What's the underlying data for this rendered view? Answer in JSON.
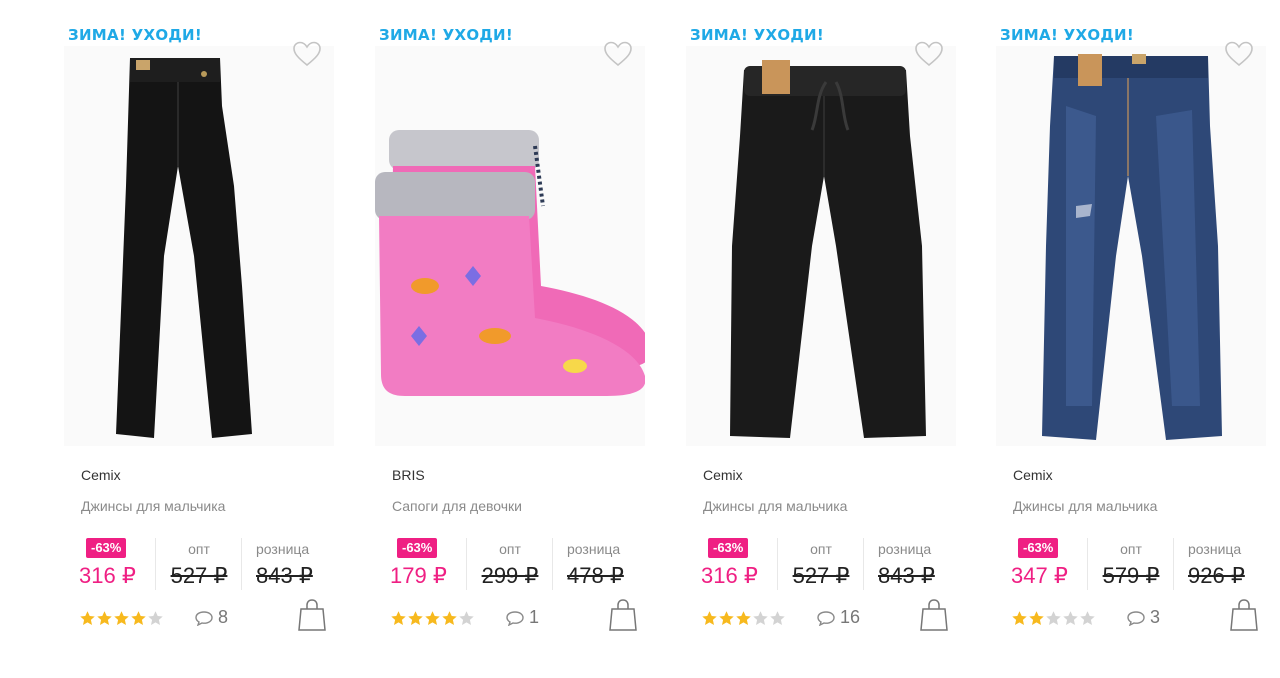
{
  "currency": "₽",
  "labels": {
    "wholesale": "опт",
    "retail": "розница"
  },
  "colors": {
    "promo": "#1fa9e6",
    "sale": "#ef1f83",
    "star_on": "#f7b91e",
    "star_off": "#d3d3d3"
  },
  "products": [
    {
      "promo": "ЗИМА! УХОДИ!",
      "brand": "Cemix",
      "title": "Джинсы для мальчика",
      "image": "black-jeans",
      "discount": "-63%",
      "sale_price": "316 ₽",
      "wholesale_price": "527 ₽",
      "retail_price": "843 ₽",
      "rating": 4,
      "rating_max": 5,
      "comments": "8"
    },
    {
      "promo": "ЗИМА! УХОДИ!",
      "brand": "BRIS",
      "title": "Сапоги для девочки",
      "image": "pink-rain-boots",
      "discount": "-63%",
      "sale_price": "179 ₽",
      "wholesale_price": "299 ₽",
      "retail_price": "478 ₽",
      "rating": 4,
      "rating_max": 5,
      "comments": "1"
    },
    {
      "promo": "ЗИМА! УХОДИ!",
      "brand": "Cemix",
      "title": "Джинсы для мальчика",
      "image": "black-jogger-jeans",
      "discount": "-63%",
      "sale_price": "316 ₽",
      "wholesale_price": "527 ₽",
      "retail_price": "843 ₽",
      "rating": 3,
      "rating_max": 5,
      "comments": "16"
    },
    {
      "promo": "ЗИМА! УХОДИ!",
      "brand": "Cemix",
      "title": "Джинсы для мальчика",
      "image": "blue-denim-jeans",
      "discount": "-63%",
      "sale_price": "347 ₽",
      "wholesale_price": "579 ₽",
      "retail_price": "926 ₽",
      "rating": 2,
      "rating_max": 5,
      "comments": "3"
    }
  ]
}
